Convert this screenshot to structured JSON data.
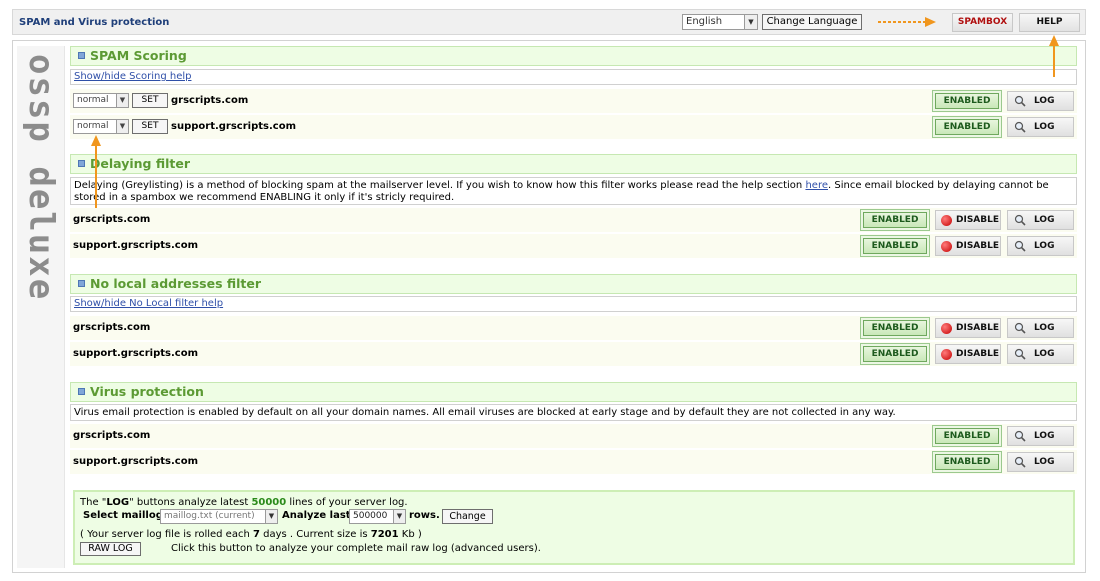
{
  "header": {
    "title": "SPAM and Virus protection",
    "language_value": "English",
    "change_language_label": "Change Language",
    "spambox_label": "SPAMBOX",
    "help_label": "HELP"
  },
  "sidebar": {
    "logo_text": "ossp deluxe"
  },
  "sections": {
    "spam_scoring": {
      "title": "SPAM Scoring",
      "help_link": "Show/hide Scoring help",
      "rows": [
        {
          "level": "normal",
          "set_label": "SET",
          "domain": "grscripts.com",
          "enabled_label": "ENABLED",
          "log_label": "LOG"
        },
        {
          "level": "normal",
          "set_label": "SET",
          "domain": "support.grscripts.com",
          "enabled_label": "ENABLED",
          "log_label": "LOG"
        }
      ]
    },
    "delaying": {
      "title": "Delaying filter",
      "desc_part1": "Delaying (Greylisting) is a method of blocking spam at the mailserver level. If you wish to know how this filter works please read the help section ",
      "desc_link": "here",
      "desc_part2": ". Since email blocked by delaying cannot be stored in a spambox we recommend ENABLING it only if it's stricly required.",
      "rows": [
        {
          "domain": "grscripts.com",
          "enabled_label": "ENABLED",
          "disable_label": "DISABLE",
          "log_label": "LOG"
        },
        {
          "domain": "support.grscripts.com",
          "enabled_label": "ENABLED",
          "disable_label": "DISABLE",
          "log_label": "LOG"
        }
      ]
    },
    "no_local": {
      "title": "No local addresses filter",
      "help_link": "Show/hide No Local filter help",
      "rows": [
        {
          "domain": "grscripts.com",
          "enabled_label": "ENABLED",
          "disable_label": "DISABLE",
          "log_label": "LOG"
        },
        {
          "domain": "support.grscripts.com",
          "enabled_label": "ENABLED",
          "disable_label": "DISABLE",
          "log_label": "LOG"
        }
      ]
    },
    "virus": {
      "title": "Virus protection",
      "desc": "Virus email protection is enabled by default on all your domain names. All email viruses are blocked at early stage and by default they are not collected in any way.",
      "rows": [
        {
          "domain": "grscripts.com",
          "enabled_label": "ENABLED",
          "log_label": "LOG"
        },
        {
          "domain": "support.grscripts.com",
          "enabled_label": "ENABLED",
          "log_label": "LOG"
        }
      ]
    }
  },
  "log_info": {
    "line1_a": "The \"",
    "line1_log": "LOG",
    "line1_b": "\" buttons analyze latest ",
    "line1_count": "50000",
    "line1_c": " lines of your server log.",
    "select_maillog_label": "Select maillog",
    "maillog_value": "maillog.txt (current)",
    "analyze_last_label": "Analyze last",
    "rows_value": "500000",
    "rows_label": "rows.",
    "change_label": "Change",
    "line3_a": "( Your server log file is rolled each ",
    "line3_days": "7",
    "line3_b": " days . Current size is ",
    "line3_size": "7201",
    "line3_c": " Kb )",
    "raw_log_label": "RAW LOG",
    "raw_log_desc": "Click this button to analyze your complete mail raw log (advanced users)."
  },
  "colors": {
    "section_title": "#5c9a34",
    "section_bg": "#eefde4",
    "arrow_orange": "#f0961e",
    "spambox_red": "#b01010"
  }
}
